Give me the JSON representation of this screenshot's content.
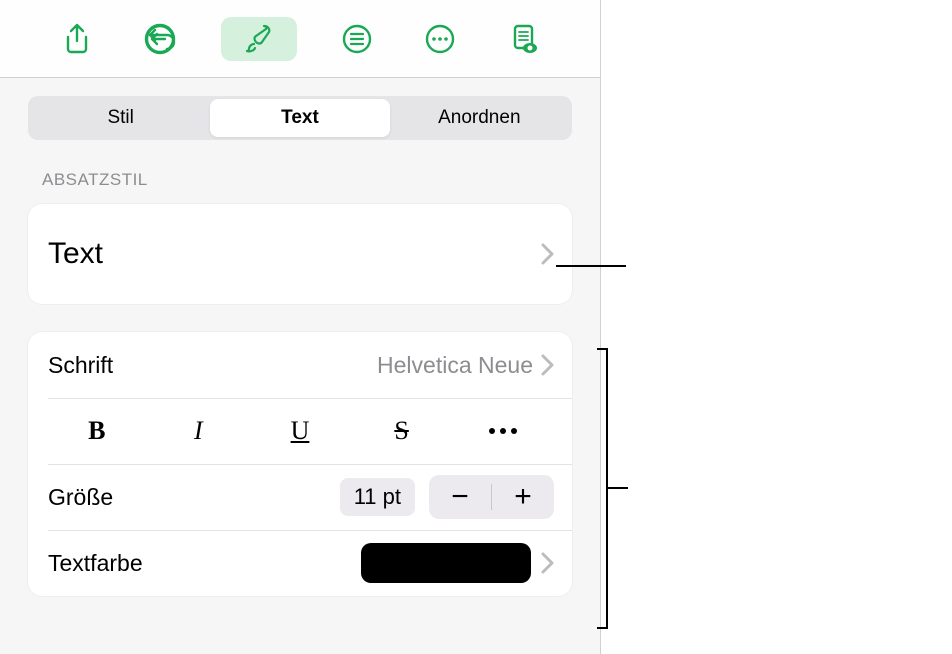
{
  "toolbar": {
    "icons": [
      "share-icon",
      "undo-icon",
      "format-brush-icon",
      "list-icon",
      "more-circle-icon",
      "document-view-icon"
    ]
  },
  "tabs": {
    "items": [
      "Stil",
      "Text",
      "Anordnen"
    ],
    "selected": 1
  },
  "paragraph_style": {
    "heading": "Absatzstil",
    "value": "Text"
  },
  "font": {
    "label": "Schrift",
    "value": "Helvetica Neue"
  },
  "format_buttons": {
    "bold": "B",
    "italic": "I",
    "underline": "U",
    "strike": "S"
  },
  "size": {
    "label": "Größe",
    "value": "11 pt",
    "minus": "−",
    "plus": "+"
  },
  "text_color": {
    "label": "Textfarbe",
    "value": "#000000"
  }
}
